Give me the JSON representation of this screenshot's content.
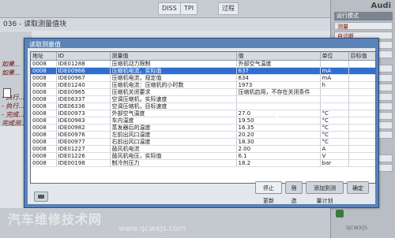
{
  "background": {
    "tabs": [
      "DISS",
      "TPI",
      "过程"
    ],
    "breadcrumb": "036 - 读取测量值块",
    "left_items": [
      "如果...",
      "如果...",
      "- 执行...",
      "- 执行...",
      "- 完成...",
      "完成测..."
    ]
  },
  "right_panel": {
    "brand": "Audi",
    "header": "运行模式",
    "items": [
      "测量",
      "自诊断",
      "Audi",
      "车辆",
      "",
      "",
      "",
      "",
      "",
      "",
      "",
      "",
      "",
      ""
    ]
  },
  "dialog": {
    "title": "读取测量值",
    "columns": [
      "地址",
      "ID",
      "测量值",
      "值",
      "单位",
      "目标值"
    ],
    "rows": [
      {
        "addr": "0008",
        "id": "IDE01288",
        "name": "压缩机动力限制",
        "value": "外部空气温度",
        "unit": "",
        "target": ""
      },
      {
        "addr": "0008",
        "id": "IDE00966",
        "name": "压缩机电流，实际值",
        "value": "637",
        "unit": "mA",
        "target": "",
        "selected": true
      },
      {
        "addr": "0008",
        "id": "IDE00967",
        "name": "压缩机电流，规定值",
        "value": "634",
        "unit": "mA",
        "target": ""
      },
      {
        "addr": "0008",
        "id": "IDE01240",
        "name": "压缩机电流：压缩机的小时数",
        "value": "1973",
        "unit": "h",
        "target": ""
      },
      {
        "addr": "0008",
        "id": "IDE00965",
        "name": "压缩机关闭要求",
        "value": "压缩机启用，不存在关闭条件",
        "unit": "",
        "target": ""
      },
      {
        "addr": "0008",
        "id": "IDE06337",
        "name": "空调压缩机，实际速度",
        "value": "",
        "unit": "",
        "target": ""
      },
      {
        "addr": "0008",
        "id": "IDE06336",
        "name": "空调压缩机，目标速度",
        "value": "",
        "unit": "",
        "target": ""
      },
      {
        "addr": "0008",
        "id": "IDE00973",
        "name": "外部空气温度",
        "value": "27.0",
        "unit": "°C",
        "target": ""
      },
      {
        "addr": "0008",
        "id": "IDE00983",
        "name": "车内温度",
        "value": "19.50",
        "unit": "°C",
        "target": ""
      },
      {
        "addr": "0008",
        "id": "IDE00982",
        "name": "蒸发器后的温度",
        "value": "16.35",
        "unit": "°C",
        "target": ""
      },
      {
        "addr": "0008",
        "id": "IDE00976",
        "name": "左前出风口温度",
        "value": "20.20",
        "unit": "°C",
        "target": ""
      },
      {
        "addr": "0008",
        "id": "IDE00977",
        "name": "右前出风口温度",
        "value": "18.30",
        "unit": "°C",
        "target": ""
      },
      {
        "addr": "0008",
        "id": "IDE01227",
        "name": "鼓风机电流",
        "value": "2.00",
        "unit": "A",
        "target": ""
      },
      {
        "addr": "0008",
        "id": "IDE01226",
        "name": "鼓风机电压，实际值",
        "value": "6.1",
        "unit": "V",
        "target": ""
      },
      {
        "addr": "0008",
        "id": "IDE00198",
        "name": "制冷剂压力",
        "value": "18.2",
        "unit": "bar",
        "target": ""
      }
    ],
    "buttons": {
      "stop": "停止更新",
      "filter": "筛选",
      "add": "添加到测量计划",
      "confirm": "确定"
    }
  },
  "watermark": {
    "title": "汽车维修技术网",
    "url": "www.qcwxjs.com",
    "right": "qcwxjs"
  }
}
